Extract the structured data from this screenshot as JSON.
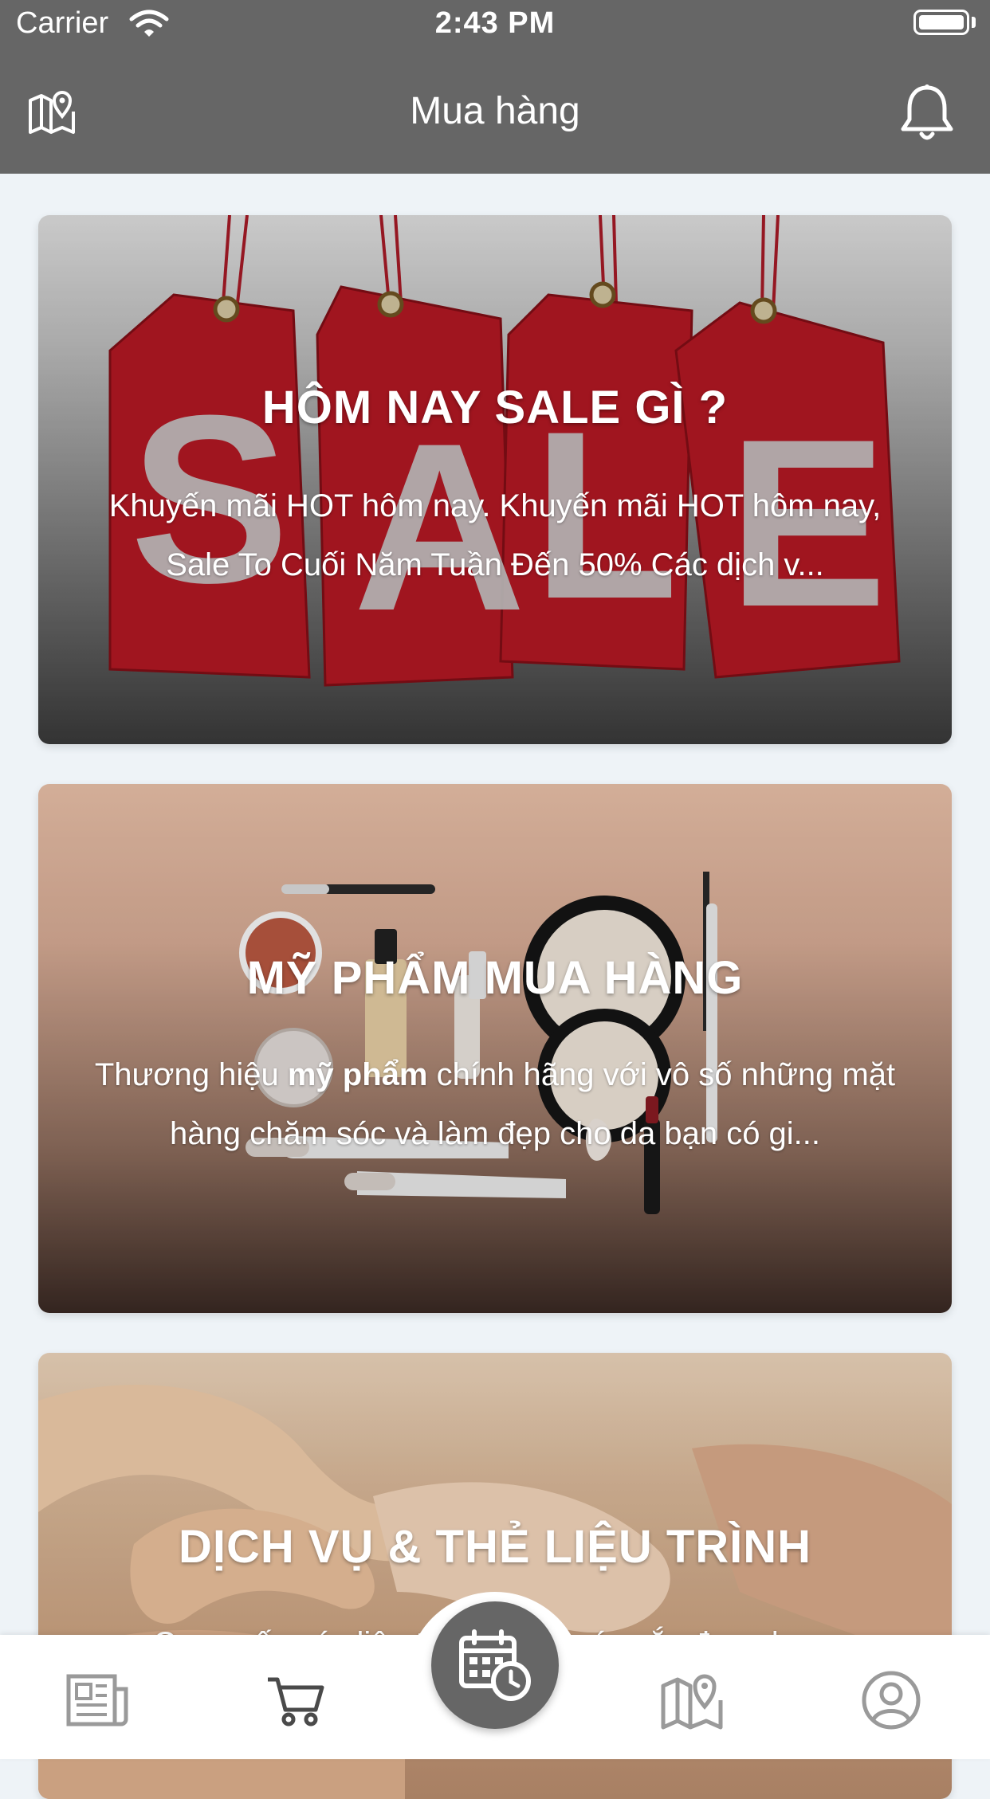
{
  "status_bar": {
    "carrier": "Carrier",
    "time": "2:43 PM"
  },
  "header": {
    "title": "Mua hàng",
    "left_icon": "map-pin-icon",
    "right_icon": "bell-icon"
  },
  "cards": [
    {
      "title": "HÔM NAY SALE GÌ ?",
      "description": "Khuyến mãi HOT hôm nay. Khuyến mãi HOT hôm nay, Sale To Cuối Năm Tuần Đến 50% Các dịch v..."
    },
    {
      "title": "MỸ PHẨM MUA HÀNG",
      "description_before": "Thương hiệu ",
      "description_bold": "mỹ phẩm",
      "description_after": " chính hãng với vô số những mặt hàng chăm sóc và làm đẹp cho da bạn có gi..."
    },
    {
      "title": "DỊCH VỤ & THẺ LIỆU TRÌNH",
      "description": "Cung cấp các liệu trình chăm sóc sắc đẹp như..."
    }
  ],
  "tabbar": {
    "items": [
      "news-icon",
      "cart-icon",
      "calendar-clock-icon",
      "map-pin-icon",
      "user-icon"
    ],
    "active": "cart-icon"
  },
  "colors": {
    "header_bg": "#666666",
    "page_bg": "#eef3f7",
    "tab_inactive": "#9a9a9a",
    "tab_active": "#4a4a4a"
  }
}
